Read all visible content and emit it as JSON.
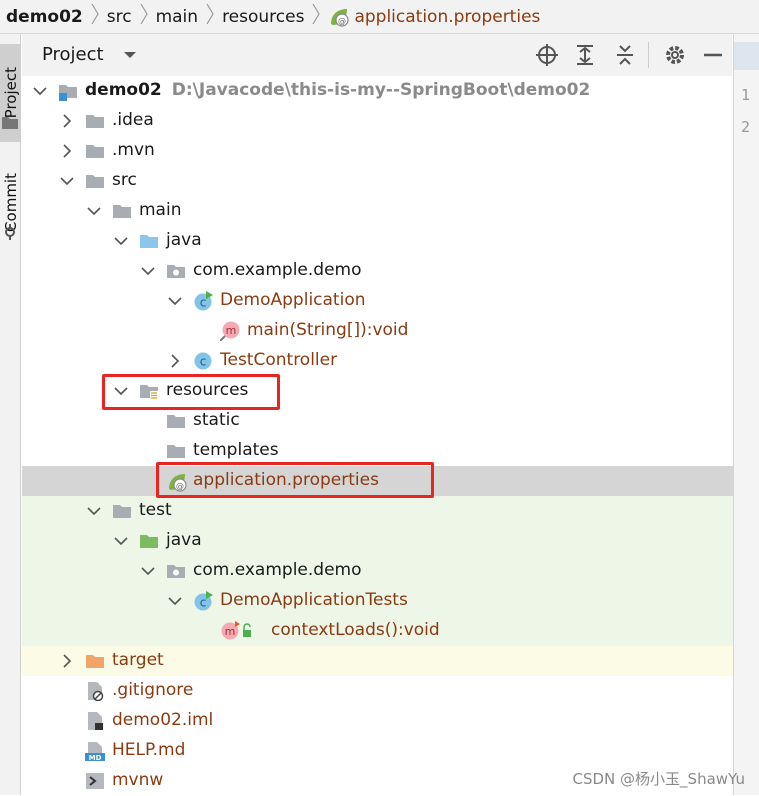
{
  "breadcrumb": [
    "demo02",
    "src",
    "main",
    "resources",
    "application.properties"
  ],
  "tool_tabs": {
    "project": "Project",
    "commit": "Commit"
  },
  "panel": {
    "title": "Project"
  },
  "gutter": {
    "lines": [
      "1",
      "2"
    ]
  },
  "tree": [
    {
      "label": "demo02",
      "path": "D:\\Javacode\\this-is-my--SpringBoot\\demo02",
      "depth": 0,
      "expand": "open",
      "icon": "module-folder-icon",
      "bold": true
    },
    {
      "label": ".idea",
      "depth": 1,
      "expand": "closed",
      "icon": "folder-icon"
    },
    {
      "label": ".mvn",
      "depth": 1,
      "expand": "closed",
      "icon": "folder-icon"
    },
    {
      "label": "src",
      "depth": 1,
      "expand": "open",
      "icon": "folder-icon"
    },
    {
      "label": "main",
      "depth": 2,
      "expand": "open",
      "icon": "folder-icon"
    },
    {
      "label": "java",
      "depth": 3,
      "expand": "open",
      "icon": "source-folder-icon"
    },
    {
      "label": "com.example.demo",
      "depth": 4,
      "expand": "open",
      "icon": "package-icon"
    },
    {
      "label": "DemoApplication",
      "depth": 5,
      "expand": "open",
      "icon": "spring-class-icon",
      "color": "#8a3b12"
    },
    {
      "label": "main(String[]):void",
      "depth": 6,
      "expand": "none",
      "icon": "method-icon",
      "color": "#8a3b12"
    },
    {
      "label": "TestController",
      "depth": 5,
      "expand": "closed",
      "icon": "class-icon",
      "color": "#8a3b12"
    },
    {
      "label": "resources",
      "depth": 3,
      "expand": "open",
      "icon": "resources-folder-icon"
    },
    {
      "label": "static",
      "depth": 4,
      "expand": "none",
      "icon": "folder-icon"
    },
    {
      "label": "templates",
      "depth": 4,
      "expand": "none",
      "icon": "folder-icon"
    },
    {
      "label": "application.properties",
      "depth": 4,
      "expand": "none",
      "icon": "spring-properties-icon",
      "color": "#8a3b12"
    },
    {
      "label": "test",
      "depth": 2,
      "expand": "open",
      "icon": "folder-icon"
    },
    {
      "label": "java",
      "depth": 3,
      "expand": "open",
      "icon": "test-folder-icon"
    },
    {
      "label": "com.example.demo",
      "depth": 4,
      "expand": "open",
      "icon": "package-icon"
    },
    {
      "label": "DemoApplicationTests",
      "depth": 5,
      "expand": "open",
      "icon": "spring-class-icon",
      "color": "#8a3b12"
    },
    {
      "label": "contextLoads():void",
      "depth": 6,
      "expand": "none",
      "icon": "test-method-icon",
      "color": "#8a3b12"
    },
    {
      "label": "target",
      "depth": 1,
      "expand": "closed",
      "icon": "excluded-folder-icon",
      "color": "#8a3b12"
    },
    {
      "label": ".gitignore",
      "depth": 1,
      "expand": "none",
      "icon": "ignore-file-icon",
      "color": "#8a3b12"
    },
    {
      "label": "demo02.iml",
      "depth": 1,
      "expand": "none",
      "icon": "iml-file-icon",
      "color": "#8a3b12"
    },
    {
      "label": "HELP.md",
      "depth": 1,
      "expand": "none",
      "icon": "markdown-file-icon",
      "color": "#8a3b12"
    },
    {
      "label": "mvnw",
      "depth": 1,
      "expand": "none",
      "icon": "script-file-icon",
      "color": "#8a3b12"
    }
  ],
  "row_state": {
    "selected": "application.properties",
    "test_tint": "#eef6e8",
    "target_tint": "#fbfbe6",
    "selection_color": "#d5d5d5",
    "highlight_color": "#e8261f"
  },
  "watermark": "CSDN @杨小玉_ShawYu"
}
